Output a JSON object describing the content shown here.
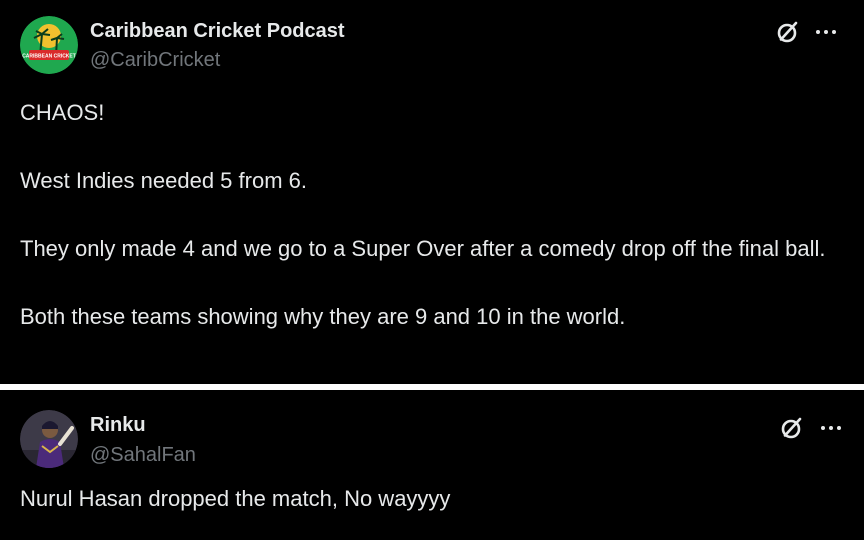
{
  "posts": [
    {
      "author_name": "Caribbean Cricket Podcast",
      "handle": "@CaribCricket",
      "avatar_text": "CARIBBEAN CRICKET",
      "paragraphs": [
        "CHAOS!",
        "West Indies needed 5 from 6.",
        "They only made 4 and we go to a Super Over after a comedy drop off the final ball.",
        "Both these teams showing why they are 9 and 10 in the world."
      ]
    },
    {
      "author_name": "Rinku",
      "handle": "@SahalFan",
      "paragraphs": [
        "Nurul Hasan dropped the match, No wayyyy"
      ]
    }
  ],
  "icons": {
    "grok": "grok-icon",
    "more": "more-options-icon"
  },
  "colors": {
    "background": "#000000",
    "text_primary": "#e7e9ea",
    "text_secondary": "#71767b",
    "divider": "#ffffff",
    "avatar1_green": "#1fa84f",
    "avatar1_yellow": "#f2c12e"
  }
}
